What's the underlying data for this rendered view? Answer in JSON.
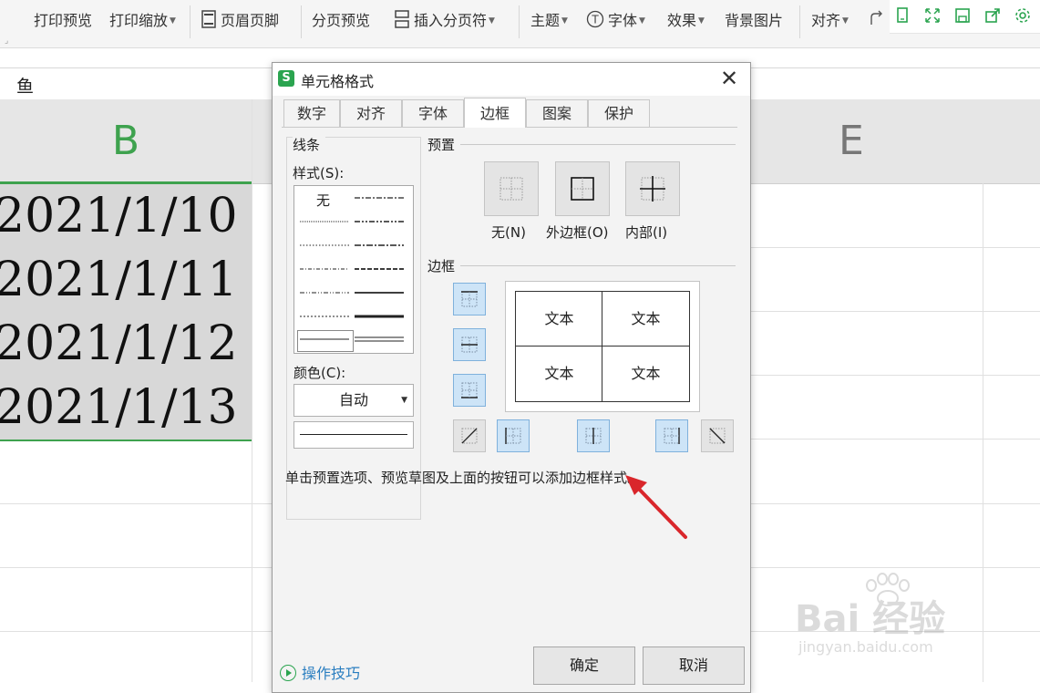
{
  "ribbon": {
    "print_preview": "打印预览",
    "print_scale": "打印缩放",
    "header_footer": "页眉页脚",
    "page_break_preview": "分页预览",
    "insert_page_break": "插入分页符",
    "theme": "主题",
    "font": "字体",
    "effects": "效果",
    "background_image": "背景图片",
    "align": "对齐"
  },
  "formula_bar": {
    "value": "鱼"
  },
  "sheet": {
    "col_b": "B",
    "col_e": "E",
    "cells": [
      "2021/1/10",
      "2021/1/11",
      "2021/1/12",
      "2021/1/13"
    ],
    "accent": "#3ea24e"
  },
  "dialog": {
    "title": "单元格格式",
    "tabs": [
      {
        "label": "数字"
      },
      {
        "label": "对齐"
      },
      {
        "label": "字体"
      },
      {
        "label": "边框",
        "active": true
      },
      {
        "label": "图案"
      },
      {
        "label": "保护"
      }
    ],
    "lines_group": "线条",
    "style_label": "样式(S):",
    "none_style": "无",
    "color_label": "颜色(C):",
    "color_value": "自动",
    "presets_group": "预置",
    "preset_none": "无(N)",
    "preset_outline": "外边框(O)",
    "preset_inside": "内部(I)",
    "border_group": "边框",
    "preview_text": "文本",
    "hint": "单击预置选项、预览草图及上面的按钮可以添加边框样式。",
    "tips": "操作技巧",
    "ok": "确定",
    "cancel": "取消"
  },
  "watermark": {
    "brand": "Bai 经验",
    "url": "jingyan.baidu.com"
  }
}
